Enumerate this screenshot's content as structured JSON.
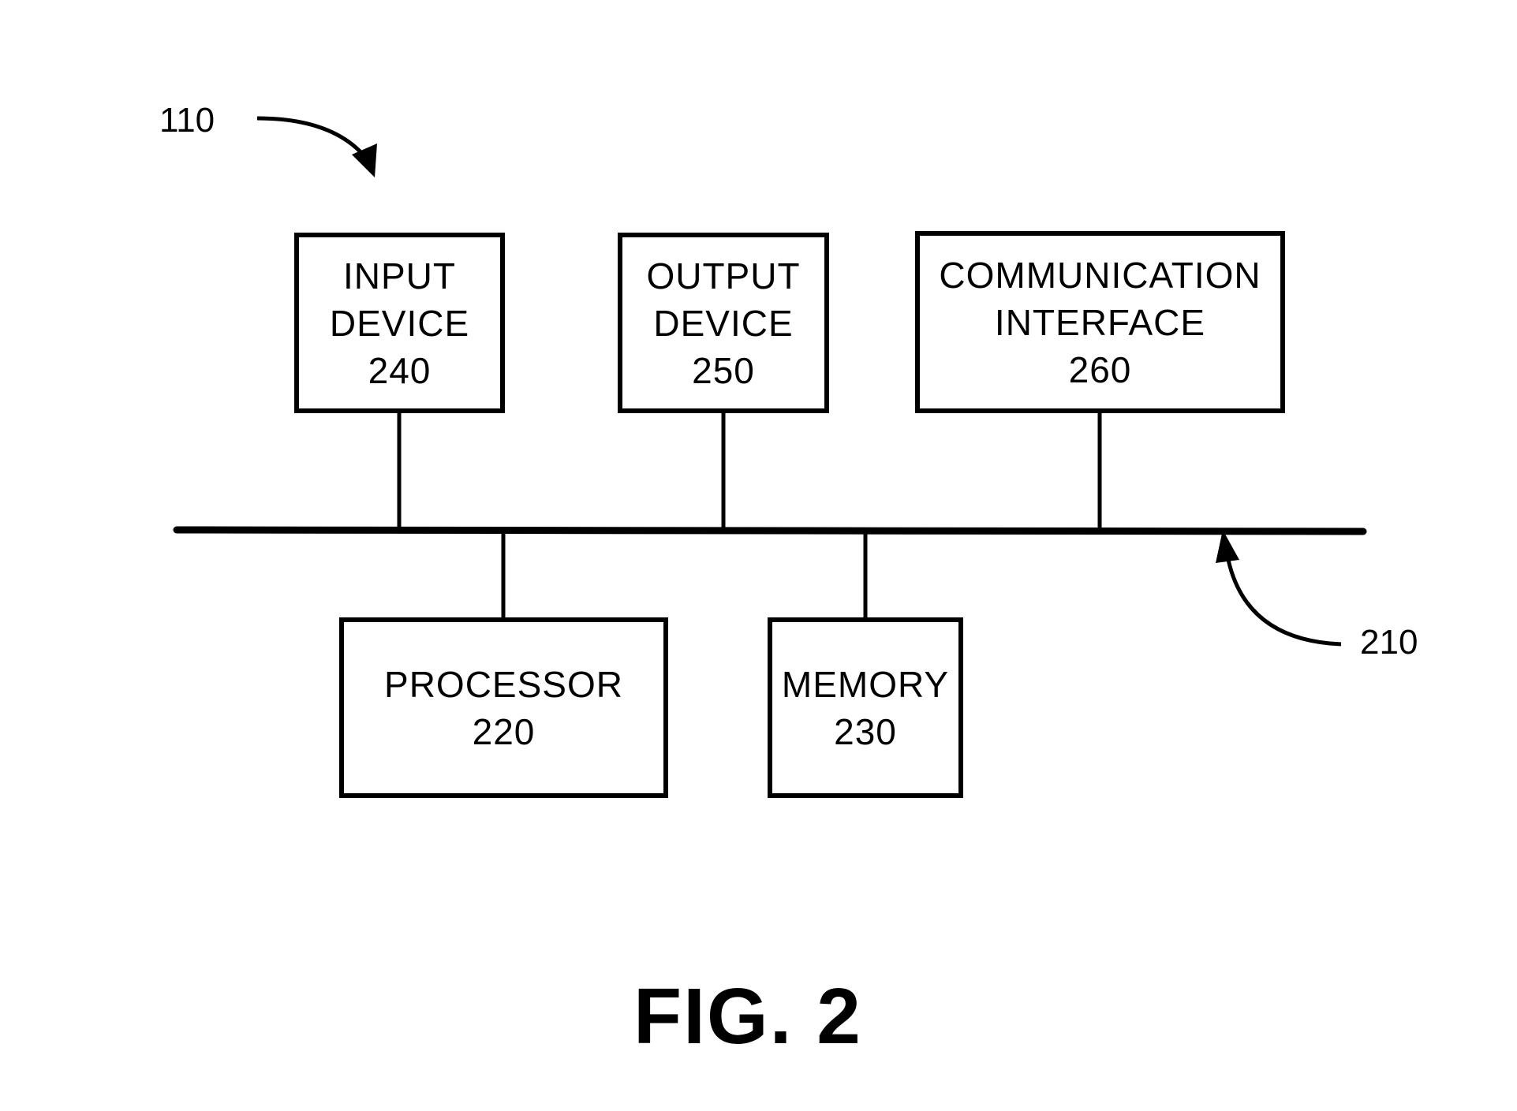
{
  "diagram": {
    "figure_label": "FIG. 2",
    "device_ref": "110",
    "bus_ref": "210",
    "components": [
      {
        "id": "input",
        "lines": [
          "INPUT",
          "DEVICE",
          "240"
        ]
      },
      {
        "id": "output",
        "lines": [
          "OUTPUT",
          "DEVICE",
          "250"
        ]
      },
      {
        "id": "comm",
        "lines": [
          "COMMUNICATION",
          "INTERFACE",
          "260"
        ]
      },
      {
        "id": "processor",
        "lines": [
          "PROCESSOR",
          "220"
        ]
      },
      {
        "id": "memory",
        "lines": [
          "MEMORY",
          "230"
        ]
      }
    ],
    "connections": [
      [
        "input",
        "bus"
      ],
      [
        "output",
        "bus"
      ],
      [
        "comm",
        "bus"
      ],
      [
        "processor",
        "bus"
      ],
      [
        "memory",
        "bus"
      ]
    ]
  }
}
